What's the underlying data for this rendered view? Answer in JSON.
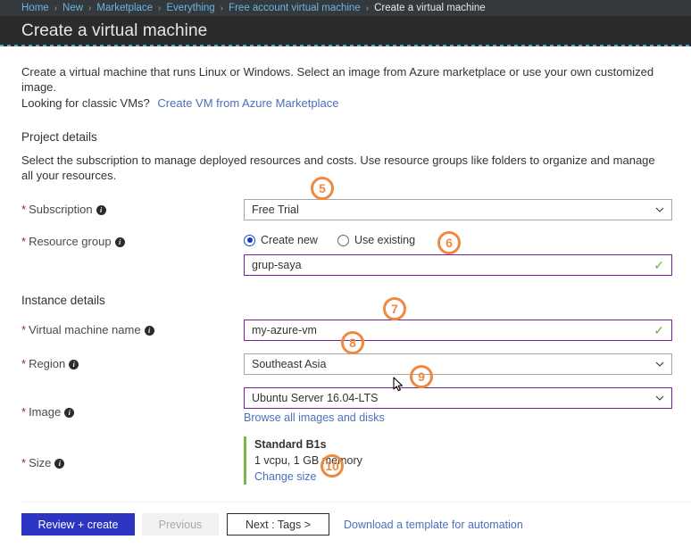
{
  "header": {
    "breadcrumb": [
      {
        "label": "Home",
        "is_link": true
      },
      {
        "label": "New",
        "is_link": true
      },
      {
        "label": "Marketplace",
        "is_link": true
      },
      {
        "label": "Everything",
        "is_link": true
      },
      {
        "label": "Free account virtual machine",
        "is_link": true
      },
      {
        "label": "Create a virtual machine",
        "is_link": false
      }
    ],
    "separator": "›",
    "title": "Create a virtual machine"
  },
  "intro": {
    "line1": "Create a virtual machine that runs Linux or Windows. Select an image from Azure marketplace or use your own customized image.",
    "line2_text": "Looking for classic VMs?",
    "line2_link": "Create VM from Azure Marketplace"
  },
  "project_details": {
    "title": "Project details",
    "description": "Select the subscription to manage deployed resources and costs. Use resource groups like folders to organize and manage all your resources.",
    "subscription": {
      "label": "Subscription",
      "required_mark": "*",
      "value": "Free Trial",
      "info": "i"
    },
    "resource_group": {
      "label": "Resource group",
      "required_mark": "*",
      "radio_create_new": "Create new",
      "radio_use_existing": "Use existing",
      "selected_radio": "Create new",
      "value": "grup-saya",
      "validation": "✓",
      "info": "i"
    }
  },
  "instance_details": {
    "title": "Instance details",
    "vm_name": {
      "label": "Virtual machine name",
      "required_mark": "*",
      "value": "my-azure-vm",
      "validation": "✓",
      "info": "i"
    },
    "region": {
      "label": "Region",
      "required_mark": "*",
      "value": "Southeast Asia",
      "info": "i"
    },
    "image": {
      "label": "Image",
      "required_mark": "*",
      "value": "Ubuntu Server 16.04-LTS",
      "browse_link": "Browse all images and disks",
      "info": "i"
    },
    "size": {
      "label": "Size",
      "required_mark": "*",
      "name": "Standard B1s",
      "spec": "1 vcpu, 1 GB memory",
      "change_link": "Change size",
      "info": "i"
    }
  },
  "footer": {
    "review_create": "Review + create",
    "previous": "Previous",
    "next": "Next : Tags >",
    "download_template": "Download a template for automation"
  },
  "annotations": {
    "badge_5": "5",
    "badge_6": "6",
    "badge_7": "7",
    "badge_8": "8",
    "badge_9": "9",
    "badge_10": "10"
  },
  "colors": {
    "accent_blue": "#2b35c2",
    "link_blue": "#4b6fbb",
    "annotation_orange": "#f0883e",
    "focus_purple": "#7b1fa2",
    "valid_green": "#6ab04c",
    "required_red": "#a4262c",
    "size_accent_green": "#7ab648",
    "header_dark": "#2b2b2b",
    "breadcrumb_dark": "#34393d"
  }
}
